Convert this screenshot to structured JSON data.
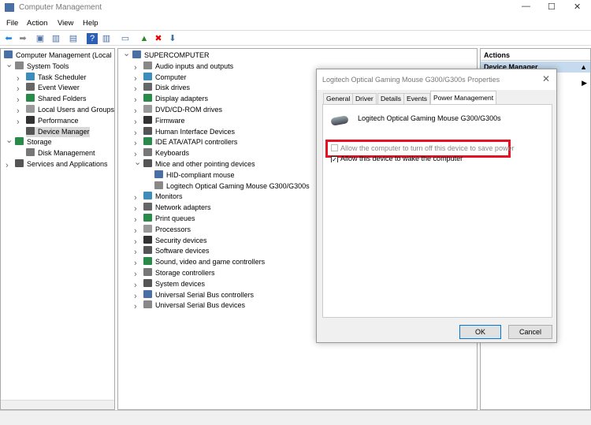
{
  "window": {
    "title": "Computer Management",
    "minimize": "—",
    "maximize": "☐",
    "close": "✕"
  },
  "menu": [
    "File",
    "Action",
    "View",
    "Help"
  ],
  "toolbar": [
    "back-icon",
    "forward-icon",
    "up-folder-icon",
    "show-hide-tree-icon",
    "properties-icon",
    "help-icon",
    "show-action-pane-icon",
    "monitor-icon",
    "update-driver-icon",
    "uninstall-icon",
    "disable-device-icon"
  ],
  "left_tree": [
    {
      "label": "Computer Management (Local",
      "level": 0,
      "chev": ""
    },
    {
      "label": "System Tools",
      "level": 1,
      "chev": "v"
    },
    {
      "label": "Task Scheduler",
      "level": 2,
      "chev": ">"
    },
    {
      "label": "Event Viewer",
      "level": 2,
      "chev": ">"
    },
    {
      "label": "Shared Folders",
      "level": 2,
      "chev": ">"
    },
    {
      "label": "Local Users and Groups",
      "level": 2,
      "chev": ">"
    },
    {
      "label": "Performance",
      "level": 2,
      "chev": ">"
    },
    {
      "label": "Device Manager",
      "level": 2,
      "chev": "",
      "selected": true
    },
    {
      "label": "Storage",
      "level": 1,
      "chev": "v"
    },
    {
      "label": "Disk Management",
      "level": 2,
      "chev": ""
    },
    {
      "label": "Services and Applications",
      "level": 1,
      "chev": ">"
    }
  ],
  "device_tree": [
    {
      "label": "SUPERCOMPUTER",
      "level": 0,
      "chev": "v"
    },
    {
      "label": "Audio inputs and outputs",
      "level": 1,
      "chev": ">"
    },
    {
      "label": "Computer",
      "level": 1,
      "chev": ">"
    },
    {
      "label": "Disk drives",
      "level": 1,
      "chev": ">"
    },
    {
      "label": "Display adapters",
      "level": 1,
      "chev": ">"
    },
    {
      "label": "DVD/CD-ROM drives",
      "level": 1,
      "chev": ">"
    },
    {
      "label": "Firmware",
      "level": 1,
      "chev": ">"
    },
    {
      "label": "Human Interface Devices",
      "level": 1,
      "chev": ">"
    },
    {
      "label": "IDE ATA/ATAPI controllers",
      "level": 1,
      "chev": ">"
    },
    {
      "label": "Keyboards",
      "level": 1,
      "chev": ">"
    },
    {
      "label": "Mice and other pointing devices",
      "level": 1,
      "chev": "v"
    },
    {
      "label": "HID-compliant mouse",
      "level": 2,
      "chev": ""
    },
    {
      "label": "Logitech Optical Gaming Mouse G300/G300s",
      "level": 2,
      "chev": ""
    },
    {
      "label": "Monitors",
      "level": 1,
      "chev": ">"
    },
    {
      "label": "Network adapters",
      "level": 1,
      "chev": ">"
    },
    {
      "label": "Print queues",
      "level": 1,
      "chev": ">"
    },
    {
      "label": "Processors",
      "level": 1,
      "chev": ">"
    },
    {
      "label": "Security devices",
      "level": 1,
      "chev": ">"
    },
    {
      "label": "Software devices",
      "level": 1,
      "chev": ">"
    },
    {
      "label": "Sound, video and game controllers",
      "level": 1,
      "chev": ">"
    },
    {
      "label": "Storage controllers",
      "level": 1,
      "chev": ">"
    },
    {
      "label": "System devices",
      "level": 1,
      "chev": ">"
    },
    {
      "label": "Universal Serial Bus controllers",
      "level": 1,
      "chev": ">"
    },
    {
      "label": "Universal Serial Bus devices",
      "level": 1,
      "chev": ">"
    }
  ],
  "actions": {
    "header": "Actions",
    "selected": "Device Manager"
  },
  "dialog": {
    "title": "Logitech Optical Gaming Mouse G300/G300s Properties",
    "tabs": [
      "General",
      "Driver",
      "Details",
      "Events",
      "Power Management"
    ],
    "active_tab": "Power Management",
    "device_name": "Logitech Optical Gaming Mouse G300/G300s",
    "option1": {
      "label": "Allow the computer to turn off this device to save power",
      "checked": false,
      "disabled": true
    },
    "option2": {
      "label": "Allow this device to wake the computer",
      "checked": true
    },
    "ok": "OK",
    "cancel": "Cancel",
    "highlight_color": "#e81123"
  }
}
